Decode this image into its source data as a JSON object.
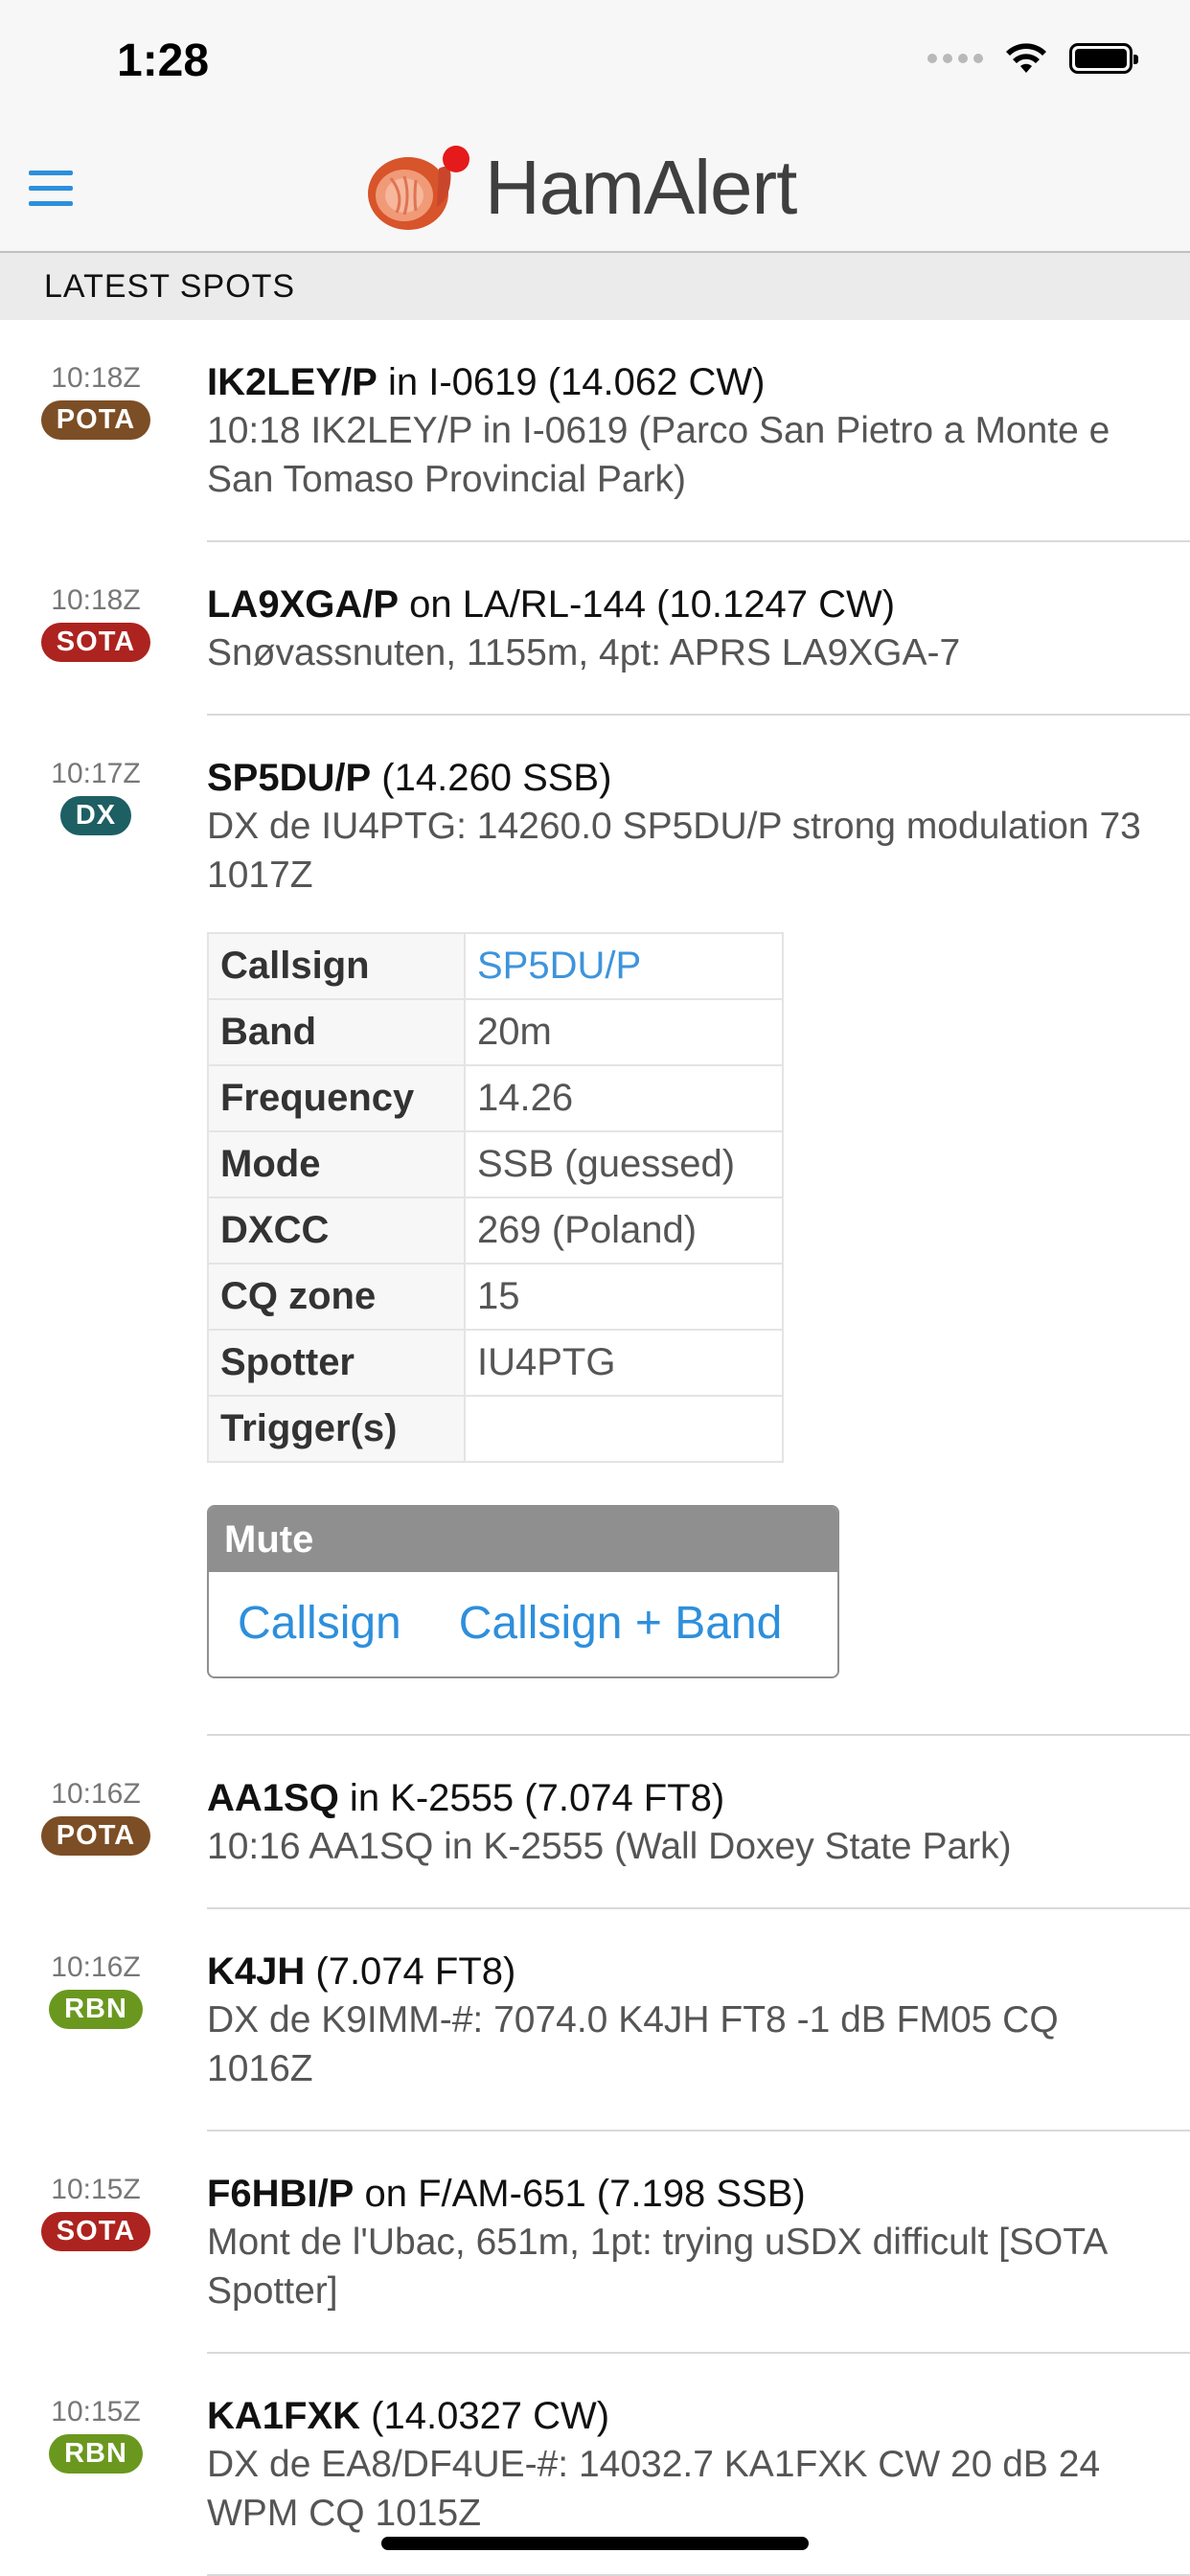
{
  "status_bar": {
    "time": "1:28"
  },
  "header": {
    "app_name": "HamAlert",
    "logo_icon": "ham-leg-logo",
    "menu_icon": "hamburger-menu-icon"
  },
  "section": {
    "title": "LATEST SPOTS"
  },
  "colors": {
    "accent": "#2d8fdc",
    "pota": "#7c4e25",
    "sota": "#ad231f",
    "dx": "#1d5f63",
    "rbn": "#6a981e"
  },
  "spots": [
    {
      "time": "10:18Z",
      "badge": "POTA",
      "call": "IK2LEY/P",
      "rest": " in I-0619 (14.062 CW)",
      "detail": "10:18 IK2LEY/P in I-0619 (Parco San Pietro a Monte e San Tomaso Provincial Park)"
    },
    {
      "time": "10:18Z",
      "badge": "SOTA",
      "call": "LA9XGA/P",
      "rest": " on LA/RL-144 (10.1247 CW)",
      "detail": "Snøvassnuten, 1155m, 4pt: APRS LA9XGA-7"
    },
    {
      "time": "10:17Z",
      "badge": "DX",
      "call": "SP5DU/P",
      "rest": " (14.260 SSB)",
      "detail": "DX de IU4PTG: 14260.0 SP5DU/P strong modulation 73 1017Z"
    },
    {
      "time": "10:16Z",
      "badge": "POTA",
      "call": "AA1SQ",
      "rest": " in K-2555 (7.074 FT8)",
      "detail": "10:16 AA1SQ in K-2555 (Wall Doxey State Park)"
    },
    {
      "time": "10:16Z",
      "badge": "RBN",
      "call": "K4JH",
      "rest": " (7.074 FT8)",
      "detail": "DX de K9IMM-#: 7074.0 K4JH FT8 -1 dB FM05 CQ 1016Z"
    },
    {
      "time": "10:15Z",
      "badge": "SOTA",
      "call": "F6HBI/P",
      "rest": " on F/AM-651 (7.198 SSB)",
      "detail": "Mont de l'Ubac, 651m, 1pt: trying uSDX difficult [SOTA Spotter]"
    },
    {
      "time": "10:15Z",
      "badge": "RBN",
      "call": "KA1FXK",
      "rest": " (14.0327 CW)",
      "detail": "DX de EA8/DF4UE-#: 14032.7 KA1FXK CW 20 dB 24 WPM CQ 1015Z"
    }
  ],
  "expanded": {
    "rows": [
      {
        "label": "Callsign",
        "value": "SP5DU/P"
      },
      {
        "label": "Band",
        "value": "20m"
      },
      {
        "label": "Frequency",
        "value": "14.26"
      },
      {
        "label": "Mode",
        "value": "SSB (guessed)"
      },
      {
        "label": "DXCC",
        "value": "269 (Poland)"
      },
      {
        "label": "CQ zone",
        "value": "15"
      },
      {
        "label": "Spotter",
        "value": "IU4PTG"
      },
      {
        "label": "Trigger(s)",
        "value": ""
      }
    ],
    "mute": {
      "title": "Mute",
      "callsign": "Callsign",
      "callsign_band": "Callsign + Band"
    }
  }
}
